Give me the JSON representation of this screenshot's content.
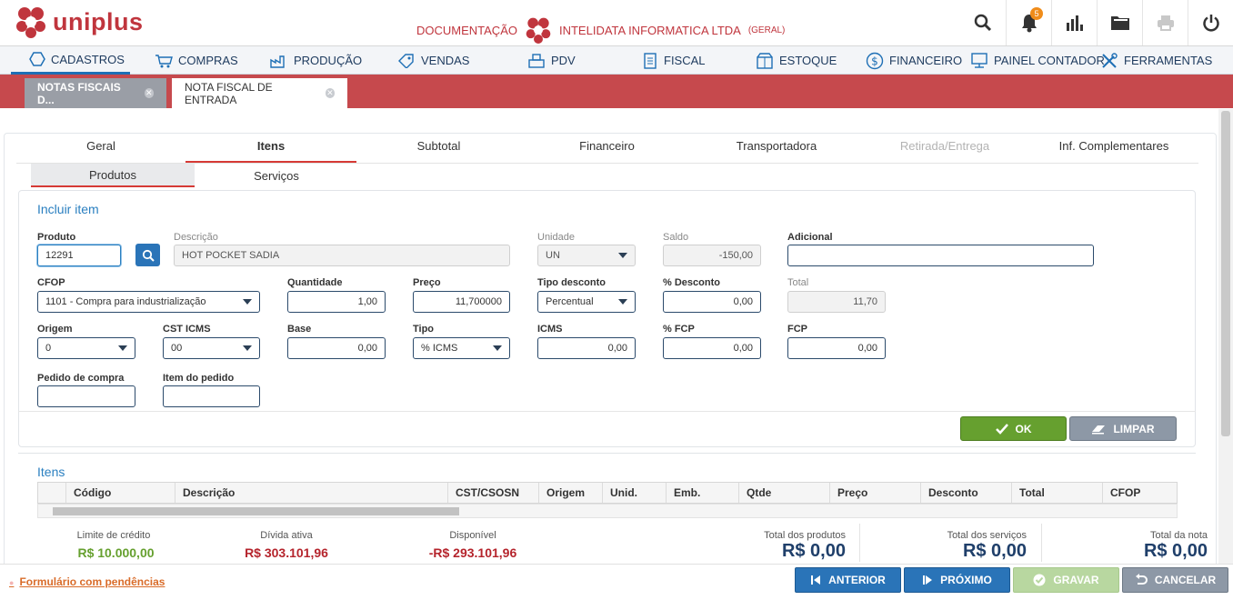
{
  "app": {
    "name": "uniplus"
  },
  "header": {
    "docs": "DOCUMENTAÇÃO",
    "company": "INTELIDATA INFORMATICA LTDA",
    "company_tag": "(GERAL)",
    "notifications": "5"
  },
  "menu": [
    {
      "label": "CADASTROS",
      "icon": "hexagon-icon"
    },
    {
      "label": "COMPRAS",
      "icon": "cart-icon"
    },
    {
      "label": "PRODUÇÃO",
      "icon": "factory-icon"
    },
    {
      "label": "VENDAS",
      "icon": "tag-icon"
    },
    {
      "label": "PDV",
      "icon": "register-icon"
    },
    {
      "label": "FISCAL",
      "icon": "document-icon"
    },
    {
      "label": "ESTOQUE",
      "icon": "box-icon"
    },
    {
      "label": "FINANCEIRO",
      "icon": "dollar-icon"
    },
    {
      "label": "PAINEL CONTADOR",
      "icon": "monitor-icon"
    },
    {
      "label": "FERRAMENTAS",
      "icon": "tools-icon"
    }
  ],
  "doc_tabs": [
    "NOTAS FISCAIS D...",
    "NOTA FISCAL DE ENTRADA"
  ],
  "section_tabs": [
    "Geral",
    "Itens",
    "Subtotal",
    "Financeiro",
    "Transportadora",
    "Retirada/Entrega",
    "Inf. Complementares"
  ],
  "sub_tabs": [
    "Produtos",
    "Serviços"
  ],
  "form": {
    "title": "Incluir item",
    "produto": {
      "label": "Produto",
      "value": "12291"
    },
    "descricao": {
      "label": "Descrição",
      "value": "HOT POCKET SADIA"
    },
    "unidade": {
      "label": "Unidade",
      "value": "UN"
    },
    "saldo": {
      "label": "Saldo",
      "value": "-150,00"
    },
    "adicional": {
      "label": "Adicional",
      "value": ""
    },
    "cfop": {
      "label": "CFOP",
      "value": "1101 - Compra para industrialização"
    },
    "quantidade": {
      "label": "Quantidade",
      "value": "1,00"
    },
    "preco": {
      "label": "Preço",
      "value": "11,700000"
    },
    "tipo_desconto": {
      "label": "Tipo desconto",
      "value": "Percentual"
    },
    "pct_desconto": {
      "label": "% Desconto",
      "value": "0,00"
    },
    "total": {
      "label": "Total",
      "value": "11,70"
    },
    "origem": {
      "label": "Origem",
      "value": "0"
    },
    "cst_icms": {
      "label": "CST ICMS",
      "value": "00"
    },
    "base": {
      "label": "Base",
      "value": "0,00"
    },
    "tipo": {
      "label": "Tipo",
      "value": "% ICMS"
    },
    "icms": {
      "label": "ICMS",
      "value": "0,00"
    },
    "pct_fcp": {
      "label": "% FCP",
      "value": "0,00"
    },
    "fcp": {
      "label": "FCP",
      "value": "0,00"
    },
    "pedido_compra": {
      "label": "Pedido de compra",
      "value": ""
    },
    "item_pedido": {
      "label": "Item do pedido",
      "value": ""
    },
    "ok": "OK",
    "limpar": "LIMPAR"
  },
  "items": {
    "title": "Itens",
    "columns": [
      "Código",
      "Descrição",
      "CST/CSOSN",
      "Origem",
      "Unid.",
      "Emb.",
      "Qtde",
      "Preço",
      "Desconto",
      "Total",
      "CFOP"
    ]
  },
  "summary": {
    "limite_label": "Limite de crédito",
    "limite": "R$ 10.000,00",
    "divida_label": "Dívida ativa",
    "divida": "R$ 303.101,96",
    "disponivel_label": "Disponível",
    "disponivel": "-R$ 293.101,96",
    "tot_produtos_label": "Total dos produtos",
    "tot_produtos": "R$ 0,00",
    "tot_servicos_label": "Total dos serviços",
    "tot_servicos": "R$ 0,00",
    "tot_nota_label": "Total da nota",
    "tot_nota": "R$ 0,00"
  },
  "footer": {
    "pendencias": "Formulário com pendências",
    "anterior": "ANTERIOR",
    "proximo": "PRÓXIMO",
    "gravar": "GRAVAR",
    "cancelar": "CANCELAR"
  },
  "colors": {
    "brand": "#c0353d",
    "accent": "#1e6fb5",
    "ok": "#66a02f"
  }
}
